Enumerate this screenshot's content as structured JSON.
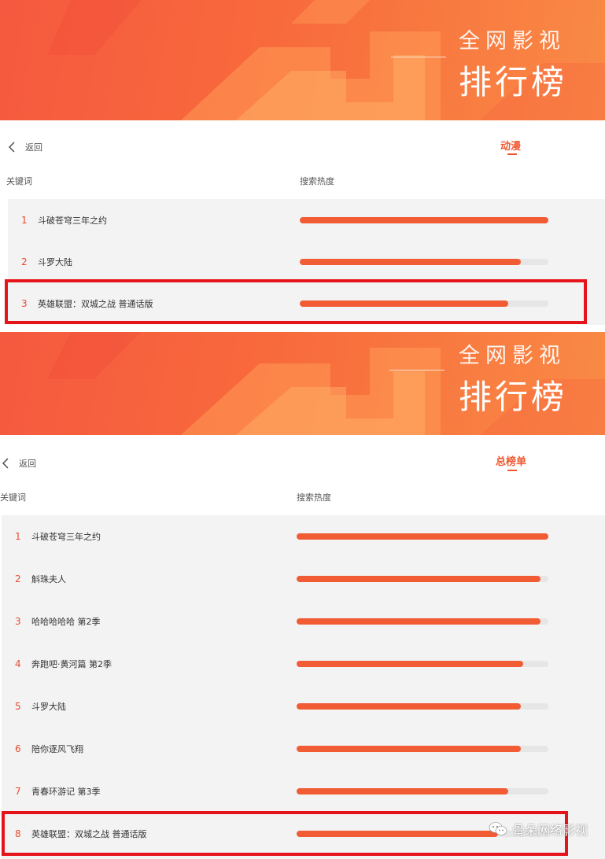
{
  "top": {
    "banner": {
      "line1": "全网影视",
      "line2": "排行榜"
    },
    "back_label": "返回",
    "tab_label": "动漫",
    "columns": {
      "keyword": "关键词",
      "heat": "搜索热度"
    },
    "rows": [
      {
        "rank": "1",
        "name": "斗破苍穹三年之约",
        "heat": 1.0
      },
      {
        "rank": "2",
        "name": "斗罗大陆",
        "heat": 0.89
      },
      {
        "rank": "3",
        "name": "英雄联盟：双城之战 普通话版",
        "heat": 0.84
      }
    ]
  },
  "bottom": {
    "banner": {
      "line1": "全网影视",
      "line2": "排行榜"
    },
    "back_label": "返回",
    "tab_label": "总榜单",
    "columns": {
      "keyword": "关键词",
      "heat": "搜索热度"
    },
    "rows": [
      {
        "rank": "1",
        "name": "斗破苍穹三年之约",
        "heat": 1.0
      },
      {
        "rank": "2",
        "name": "斛珠夫人",
        "heat": 0.97
      },
      {
        "rank": "3",
        "name": "哈哈哈哈哈 第2季",
        "heat": 0.97
      },
      {
        "rank": "4",
        "name": "奔跑吧·黄河篇 第2季",
        "heat": 0.9
      },
      {
        "rank": "5",
        "name": "斗罗大陆",
        "heat": 0.89
      },
      {
        "rank": "6",
        "name": "陪你逐风飞翔",
        "heat": 0.89
      },
      {
        "rank": "7",
        "name": "青春环游记 第3季",
        "heat": 0.84
      },
      {
        "rank": "8",
        "name": "英雄联盟：双城之战 普通话版",
        "heat": 0.8
      }
    ]
  },
  "watermark": {
    "text": "骨朵网络影视"
  },
  "colors": {
    "accent": "#f15c35",
    "highlight": "#e5141b",
    "track": "#e6e6e6"
  }
}
